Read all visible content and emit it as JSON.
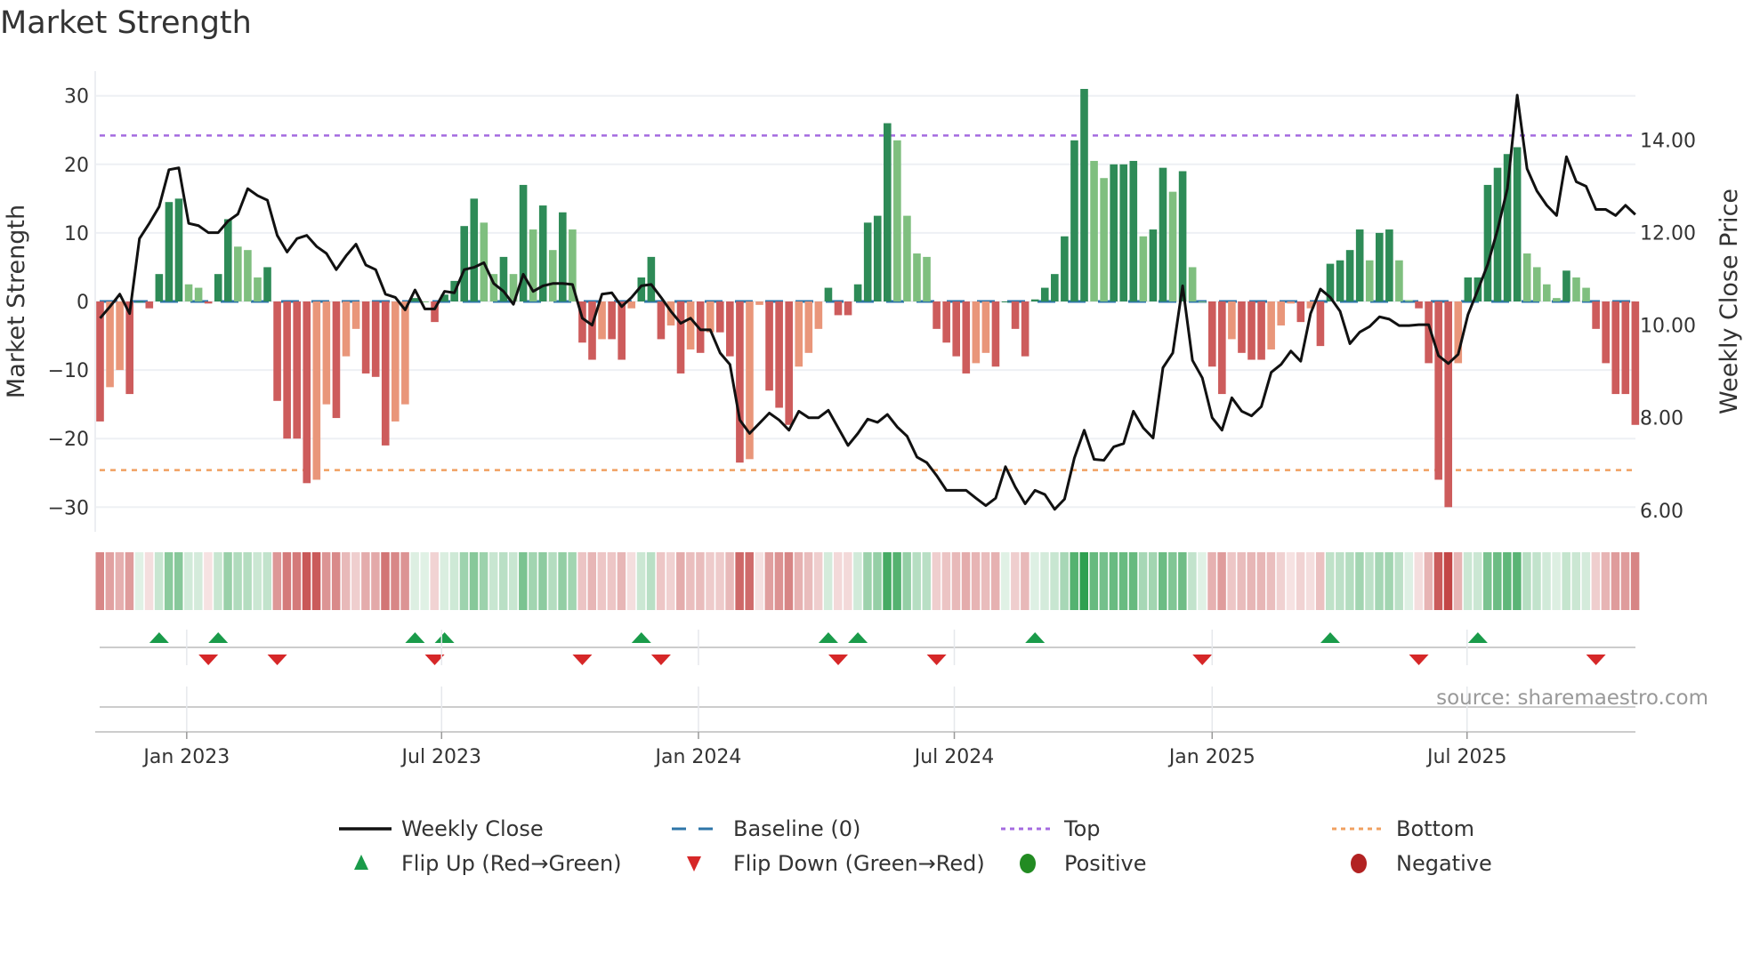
{
  "title": "Market Strength",
  "source": "source: sharemaestro.com",
  "chart_data": {
    "type": "bar",
    "title": "Market Strength",
    "ylabel": "Market Strength",
    "y2label": "Weekly Close Price",
    "ylim": [
      -33.5,
      33
    ],
    "y2lim": [
      5.5,
      15.5
    ],
    "yticks": [
      30,
      20,
      10,
      0,
      -10,
      -20,
      -30
    ],
    "ytick_labels": [
      "30",
      "20",
      "10",
      "0",
      "−10",
      "−20",
      "−30"
    ],
    "y2ticks": [
      14,
      12,
      10,
      8,
      6
    ],
    "y2tick_labels": [
      "14.00",
      "12.00",
      "10.00",
      "8.00",
      "6.00"
    ],
    "xticks": [
      {
        "label": "Jan 2023",
        "week_index": 8.8
      },
      {
        "label": "Jul 2023",
        "week_index": 34.7
      },
      {
        "label": "Jan 2024",
        "week_index": 60.8
      },
      {
        "label": "Jul 2024",
        "week_index": 86.8
      },
      {
        "label": "Jan 2025",
        "week_index": 113
      },
      {
        "label": "Jul 2025",
        "week_index": 138.9
      }
    ],
    "top_level": 24.2,
    "bottom_level": -24.6,
    "baseline": 0,
    "strength": [
      -17.5,
      -12.5,
      -10,
      -13.5,
      0,
      -1,
      4,
      14.5,
      15,
      2.5,
      2,
      -0.3,
      4,
      12,
      8,
      7.5,
      3.5,
      5,
      -14.5,
      -20,
      -20,
      -26.5,
      -26,
      -15,
      -17,
      -8,
      -4,
      -10.5,
      -11,
      -21,
      -17.5,
      -15,
      0.5,
      0,
      -3,
      1,
      3,
      11,
      15,
      11.5,
      4,
      6.5,
      4,
      17,
      10.5,
      14,
      7.5,
      13,
      10.5,
      -6,
      -8.5,
      -5.5,
      -5.5,
      -8.5,
      -1,
      3.5,
      6.5,
      -5.5,
      -3.5,
      -10.5,
      -7,
      -7.5,
      -4.5,
      -4.5,
      -8,
      -23.5,
      -23,
      -0.5,
      -13,
      -15.5,
      -18,
      -9.5,
      -7.5,
      -4,
      2,
      -2,
      -2,
      2.5,
      11.5,
      12.5,
      26,
      23.5,
      12.5,
      7,
      6.5,
      -4,
      -6,
      -8,
      -10.5,
      -9,
      -7.5,
      -9.5,
      0,
      -4,
      -8,
      0.3,
      2,
      4,
      9.5,
      23.5,
      31,
      20.5,
      18,
      20,
      20,
      20.5,
      9.5,
      10.5,
      19.5,
      16,
      19,
      5,
      0,
      -9.5,
      -13.5,
      -5.5,
      -7.5,
      -8.5,
      -8.5,
      -7,
      -3.5,
      -0.3,
      -3,
      -1,
      -6.5,
      5.5,
      6,
      7.5,
      10.5,
      6,
      10,
      10.5,
      6,
      0.2,
      -1,
      -9,
      -26,
      -30,
      -9,
      3.5,
      3.5,
      17,
      19.5,
      21.5,
      22.5,
      7,
      5,
      2.5,
      0.5,
      4.5,
      3.5,
      2,
      -4,
      -9,
      -13.5,
      -13.5,
      -18
    ],
    "weekly_close": [
      10.15,
      10.4,
      10.67,
      10.25,
      11.87,
      12.2,
      12.56,
      13.36,
      13.4,
      12.2,
      12.15,
      12.0,
      12.0,
      12.25,
      12.4,
      12.95,
      12.8,
      12.7,
      11.94,
      11.58,
      11.87,
      11.94,
      11.7,
      11.55,
      11.2,
      11.5,
      11.75,
      11.3,
      11.2,
      10.67,
      10.6,
      10.33,
      10.76,
      10.35,
      10.35,
      10.73,
      10.7,
      11.2,
      11.25,
      11.35,
      10.9,
      10.73,
      10.45,
      11.1,
      10.73,
      10.85,
      10.9,
      10.9,
      10.88,
      10.15,
      10.0,
      10.67,
      10.7,
      10.4,
      10.6,
      10.85,
      10.88,
      10.6,
      10.3,
      10.04,
      10.15,
      9.9,
      9.9,
      9.4,
      9.15,
      7.95,
      7.66,
      7.88,
      8.1,
      7.95,
      7.73,
      8.14,
      8.0,
      8.0,
      8.16,
      7.78,
      7.4,
      7.66,
      7.97,
      7.9,
      8.07,
      7.8,
      7.6,
      7.15,
      7.03,
      6.75,
      6.43,
      6.43,
      6.43,
      6.26,
      6.1,
      6.26,
      6.94,
      6.5,
      6.14,
      6.43,
      6.34,
      6.02,
      6.24,
      7.13,
      7.73,
      7.1,
      7.08,
      7.37,
      7.44,
      8.14,
      7.78,
      7.56,
      9.08,
      9.4,
      10.85,
      9.24,
      8.86,
      8.0,
      7.73,
      8.43,
      8.14,
      8.04,
      8.24,
      8.98,
      9.15,
      9.44,
      9.22,
      10.25,
      10.78,
      10.6,
      10.3,
      9.6,
      9.85,
      9.97,
      10.18,
      10.13,
      9.99,
      9.99,
      10.01,
      10.01,
      9.34,
      9.17,
      9.37,
      10.23,
      10.76,
      11.31,
      12.06,
      12.95,
      14.97,
      13.38,
      12.9,
      12.59,
      12.37,
      13.64,
      13.1,
      13.0,
      12.5,
      12.5,
      12.37,
      12.59,
      12.39
    ],
    "flip_up_week_index": [
      6,
      12,
      32,
      35,
      55,
      74,
      77,
      95,
      125,
      140
    ],
    "flip_down_week_index": [
      11,
      18,
      34,
      49,
      57,
      75,
      85,
      112,
      134,
      152
    ],
    "legend": {
      "placement": "bottom",
      "items": [
        {
          "label": "Weekly Close",
          "type": "line",
          "color": "#111111"
        },
        {
          "label": "Baseline (0)",
          "type": "dash",
          "color": "#2e75a8"
        },
        {
          "label": "Top",
          "type": "dot",
          "color": "#a56be0"
        },
        {
          "label": "Bottom",
          "type": "dot",
          "color": "#f0a060"
        },
        {
          "label": "Flip Up (Red→Green)",
          "type": "tri-up",
          "color": "#1a9b4a"
        },
        {
          "label": "Flip Down (Green→Red)",
          "type": "tri-down",
          "color": "#d62728"
        },
        {
          "label": "Positive",
          "type": "circle",
          "color": "#228b22"
        },
        {
          "label": "Negative",
          "type": "circle",
          "color": "#b22222"
        }
      ]
    },
    "colors": {
      "pos_strong": "#2e8b57",
      "pos_weak": "#7fbf7f",
      "neg_strong": "#cd5c5c",
      "neg_weak": "#e9967a",
      "grid": "#eef0f4",
      "axis": "#cccccc"
    }
  }
}
